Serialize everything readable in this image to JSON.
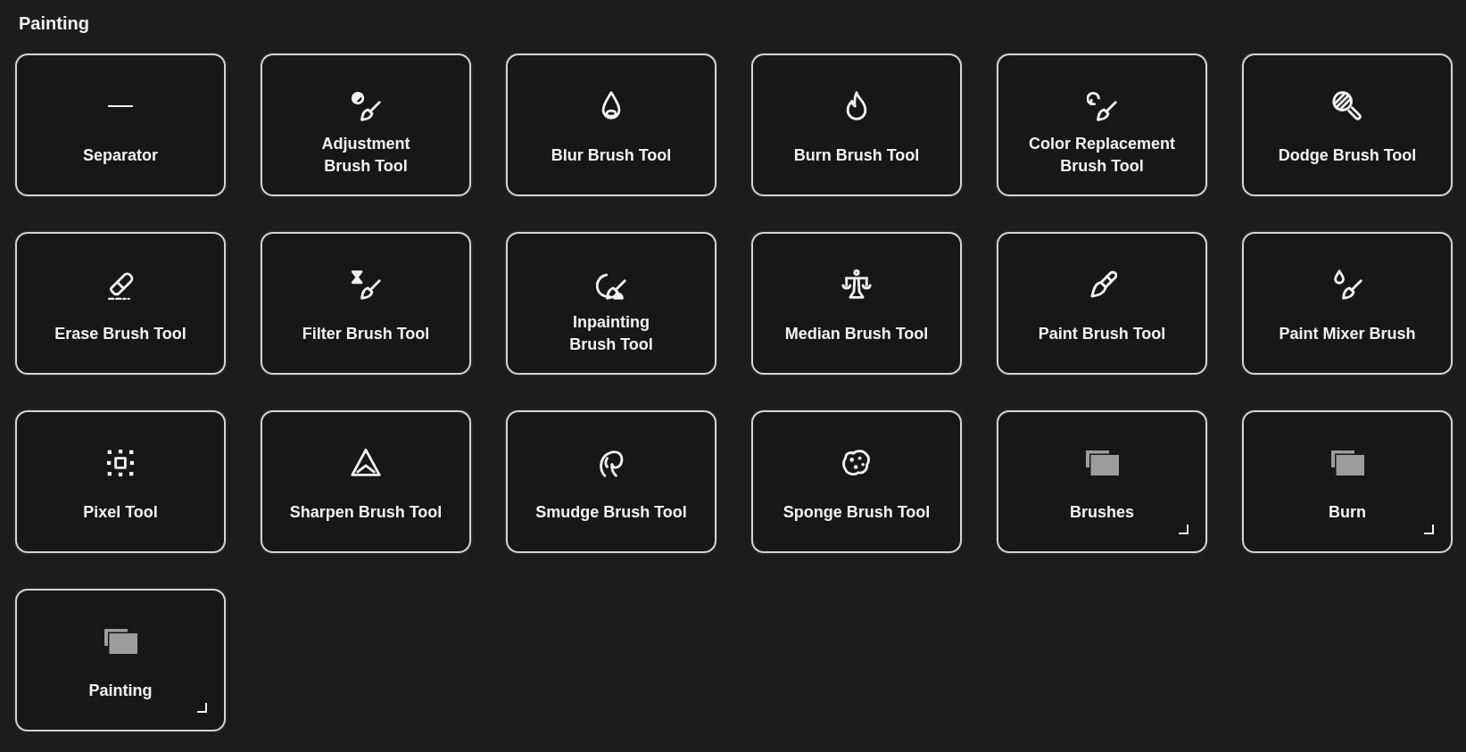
{
  "section": {
    "title": "Painting"
  },
  "items": [
    {
      "label": "Separator",
      "kind": "separator"
    },
    {
      "label": "Adjustment Brush Tool",
      "kind": "tool"
    },
    {
      "label": "Blur Brush Tool",
      "kind": "tool"
    },
    {
      "label": "Burn Brush Tool",
      "kind": "tool"
    },
    {
      "label": "Color Replacement Brush Tool",
      "kind": "tool"
    },
    {
      "label": "Dodge Brush Tool",
      "kind": "tool"
    },
    {
      "label": "Erase Brush Tool",
      "kind": "tool"
    },
    {
      "label": "Filter Brush Tool",
      "kind": "tool"
    },
    {
      "label": "Inpainting Brush Tool",
      "kind": "tool"
    },
    {
      "label": "Median Brush Tool",
      "kind": "tool"
    },
    {
      "label": "Paint Brush Tool",
      "kind": "tool"
    },
    {
      "label": "Paint Mixer Brush",
      "kind": "tool"
    },
    {
      "label": "Pixel Tool",
      "kind": "tool"
    },
    {
      "label": "Sharpen Brush Tool",
      "kind": "tool"
    },
    {
      "label": "Smudge Brush Tool",
      "kind": "tool"
    },
    {
      "label": "Sponge Brush Tool",
      "kind": "tool"
    },
    {
      "label": "Brushes",
      "kind": "group"
    },
    {
      "label": "Burn",
      "kind": "group"
    },
    {
      "label": "Painting",
      "kind": "group"
    }
  ]
}
